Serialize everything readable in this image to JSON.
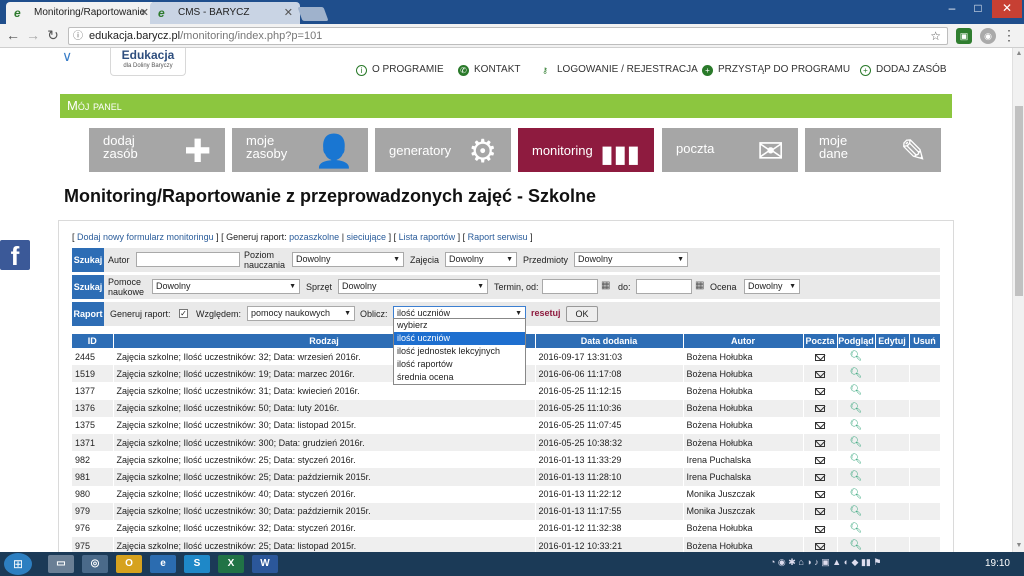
{
  "browser": {
    "tabs": [
      {
        "label": "Monitoring/Raportowanie"
      },
      {
        "label": "CMS - BARYCZ"
      }
    ],
    "url": {
      "host": "edukacja.barycz.pl",
      "path": "/monitoring/index.php?p=101"
    }
  },
  "site": {
    "logo_title": "Edukacja",
    "logo_subtitle": "dla Doliny Baryczy",
    "topnav": [
      "O PROGRAMIE",
      "KONTAKT",
      "LOGOWANIE / REJESTRACJA",
      "PRZYSTĄP DO PROGRAMU",
      "DODAJ ZASÓB"
    ],
    "panel_title": "Mój panel",
    "tiles": [
      {
        "line1": "dodaj",
        "line2": "zasób"
      },
      {
        "line1": "moje",
        "line2": "zasoby"
      },
      {
        "line1": "generatory",
        "line2": ""
      },
      {
        "line1": "monitoring",
        "line2": ""
      },
      {
        "line1": "poczta",
        "line2": ""
      },
      {
        "line1": "moje",
        "line2": "dane"
      }
    ]
  },
  "page_title": "Monitoring/Raportowanie z przeprowadzonych zajęć - Szkolne",
  "links": {
    "add_form": "Dodaj nowy formularz monitoringu",
    "generate_label": "Generuj raport:",
    "generate_school": "pozaszkolne",
    "generate_net": "sieciujące",
    "report_list": "Lista raportów",
    "service_report": "Raport serwisu"
  },
  "filters": {
    "search_label": "Szukaj",
    "author_label": "Autor",
    "level_label": "Poziom nauczania",
    "level_value": "Dowolny",
    "classes_label": "Zajęcia",
    "classes_value": "Dowolny",
    "subjects_label": "Przedmioty",
    "subjects_value": "Dowolny",
    "aids_label": "Pomoce naukowe",
    "aids_value": "Dowolny",
    "equipment_label": "Sprzęt",
    "equipment_value": "Dowolny",
    "date_from_label": "Termin, od:",
    "date_to_label": "do:",
    "grade_label": "Ocena",
    "grade_value": "Dowolny"
  },
  "report": {
    "label": "Raport",
    "generate_label": "Generuj raport:",
    "by_label": "Względem:",
    "by_value": "pomocy naukowych",
    "calc_label": "Oblicz:",
    "calc_value": "ilość uczniów",
    "reset": "resetuj",
    "ok": "OK",
    "options": [
      "wybierz",
      "ilość uczniów",
      "ilość jednostek lekcyjnych",
      "ilość raportów",
      "średnia ocena"
    ]
  },
  "table": {
    "headers": [
      "ID",
      "Rodzaj",
      "Data dodania",
      "Autor",
      "Poczta",
      "Podgląd",
      "Edytuj",
      "Usuń"
    ],
    "rows": [
      {
        "id": "2445",
        "kind": "Zajęcia szkolne; Ilość uczestników: 32; Data: wrzesień 2016r.",
        "date": "2016-09-17 13:31:03",
        "author": "Bożena Hołubka"
      },
      {
        "id": "1519",
        "kind": "Zajęcia szkolne; Ilość uczestników: 19; Data: marzec 2016r.",
        "date": "2016-06-06 11:17:08",
        "author": "Bożena Hołubka"
      },
      {
        "id": "1377",
        "kind": "Zajęcia szkolne; Ilość uczestników: 31; Data: kwiecień 2016r.",
        "date": "2016-05-25 11:12:15",
        "author": "Bożena Hołubka"
      },
      {
        "id": "1376",
        "kind": "Zajęcia szkolne; Ilość uczestników: 50; Data: luty 2016r.",
        "date": "2016-05-25 11:10:36",
        "author": "Bożena Hołubka"
      },
      {
        "id": "1375",
        "kind": "Zajęcia szkolne; Ilość uczestników: 30; Data: listopad 2015r.",
        "date": "2016-05-25 11:07:45",
        "author": "Bożena Hołubka"
      },
      {
        "id": "1371",
        "kind": "Zajęcia szkolne; Ilość uczestników: 300; Data: grudzień 2016r.",
        "date": "2016-05-25 10:38:32",
        "author": "Bożena Hołubka"
      },
      {
        "id": "982",
        "kind": "Zajęcia szkolne; Ilość uczestników: 25; Data: styczeń 2016r.",
        "date": "2016-01-13 11:33:29",
        "author": "Irena Puchalska"
      },
      {
        "id": "981",
        "kind": "Zajęcia szkolne; Ilość uczestników: 25; Data: październik 2015r.",
        "date": "2016-01-13 11:28:10",
        "author": "Irena Puchalska"
      },
      {
        "id": "980",
        "kind": "Zajęcia szkolne; Ilość uczestników: 40; Data: styczeń 2016r.",
        "date": "2016-01-13 11:22:12",
        "author": "Monika Juszczak"
      },
      {
        "id": "979",
        "kind": "Zajęcia szkolne; Ilość uczestników: 30; Data: październik 2015r.",
        "date": "2016-01-13 11:17:55",
        "author": "Monika Juszczak"
      },
      {
        "id": "976",
        "kind": "Zajęcia szkolne; Ilość uczestników: 32; Data: styczeń 2016r.",
        "date": "2016-01-12 11:32:38",
        "author": "Bożena Hołubka"
      },
      {
        "id": "975",
        "kind": "Zajęcia szkolne; Ilość uczestników: 25; Data: listopad 2015r.",
        "date": "2016-01-12 10:33:21",
        "author": "Bożena Hołubka"
      }
    ]
  },
  "taskbar": {
    "clock": "19:10"
  }
}
